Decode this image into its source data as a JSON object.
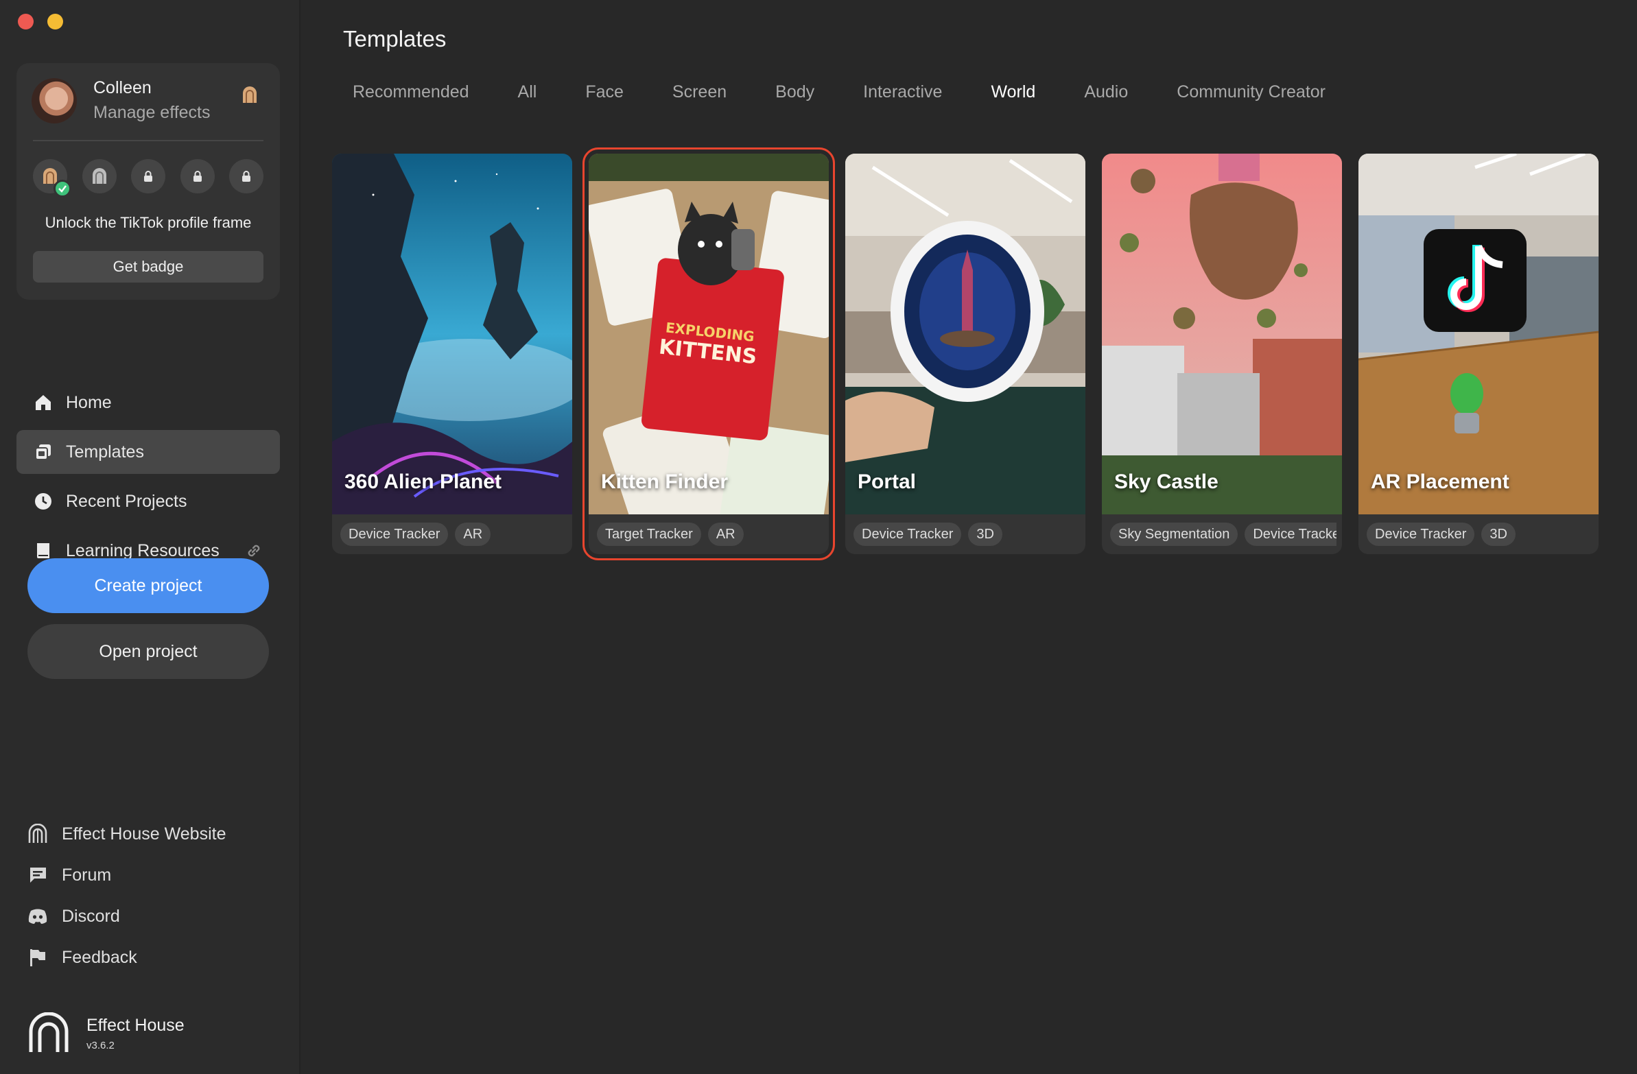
{
  "profile": {
    "name": "Colleen",
    "subtitle": "Manage effects",
    "unlock_text": "Unlock the TikTok profile frame",
    "get_badge_label": "Get badge"
  },
  "nav": {
    "items": [
      {
        "label": "Home",
        "icon": "home-icon"
      },
      {
        "label": "Templates",
        "icon": "templates-icon",
        "active": true
      },
      {
        "label": "Recent Projects",
        "icon": "clock-icon"
      },
      {
        "label": "Learning Resources",
        "icon": "book-icon"
      }
    ]
  },
  "actions": {
    "create_label": "Create project",
    "open_label": "Open project"
  },
  "footer": {
    "links": [
      {
        "label": "Effect House Website",
        "icon": "effect-house-icon"
      },
      {
        "label": "Forum",
        "icon": "forum-icon"
      },
      {
        "label": "Discord",
        "icon": "discord-icon"
      },
      {
        "label": "Feedback",
        "icon": "flag-icon"
      }
    ]
  },
  "brand": {
    "name": "Effect House",
    "version": "v3.6.2"
  },
  "main": {
    "title": "Templates",
    "tabs": [
      "Recommended",
      "All",
      "Face",
      "Screen",
      "Body",
      "Interactive",
      "World",
      "Audio",
      "Community Creator"
    ],
    "active_tab": "World",
    "cards": [
      {
        "title": "360 Alien Planet",
        "tags": [
          "Device Tracker",
          "AR"
        ]
      },
      {
        "title": "Kitten Finder",
        "tags": [
          "Target Tracker",
          "AR"
        ],
        "selected": true,
        "image_text": [
          "EXPLODING",
          "KITTENS"
        ]
      },
      {
        "title": "Portal",
        "tags": [
          "Device Tracker",
          "3D"
        ]
      },
      {
        "title": "Sky Castle",
        "tags": [
          "Sky Segmentation",
          "Device Tracker"
        ]
      },
      {
        "title": "AR Placement",
        "tags": [
          "Device Tracker",
          "3D"
        ]
      }
    ]
  },
  "colors": {
    "accent": "#4a8ff0",
    "selection": "#e8452e",
    "background": "#282828",
    "sidebar": "#2b2b2b"
  }
}
